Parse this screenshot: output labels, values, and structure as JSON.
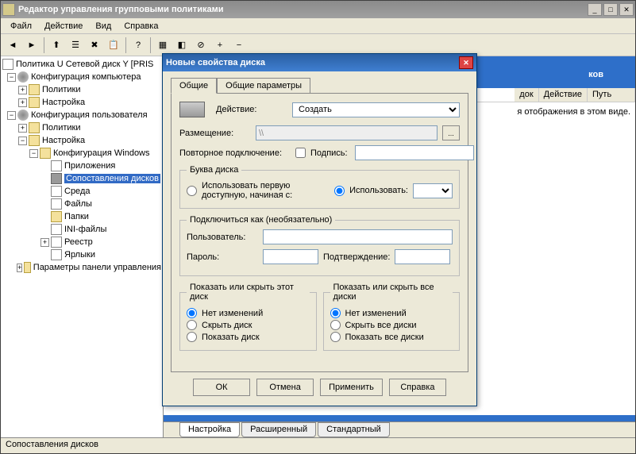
{
  "main": {
    "title": "Редактор управления групповыми политиками",
    "menu": [
      "Файл",
      "Действие",
      "Вид",
      "Справка"
    ],
    "status": "Сопоставления дисков"
  },
  "tree": {
    "root": "Политика U Сетевой диск Y [PRIS",
    "comp_config": "Конфигурация компьютера",
    "comp_policies": "Политики",
    "comp_settings": "Настройка",
    "user_config": "Конфигурация пользователя",
    "user_policies": "Политики",
    "user_settings": "Настройка",
    "win_config": "Конфигурация Windows",
    "apps": "Приложения",
    "drive_maps": "Сопоставления дисков",
    "env": "Среда",
    "files": "Файлы",
    "folders": "Папки",
    "ini": "INI-файлы",
    "registry": "Реестр",
    "shortcuts": "Ярлыки",
    "cpanel": "Параметры панели управления"
  },
  "right": {
    "header_suffix": "ков",
    "cols": {
      "order": "док",
      "action": "Действие",
      "path": "Путь"
    },
    "empty": "я отображения в этом виде.",
    "tabs": [
      "Настройка",
      "Расширенный",
      "Стандартный"
    ]
  },
  "dialog": {
    "title": "Новые свойства диска",
    "tabs": {
      "general": "Общие",
      "common": "Общие параметры"
    },
    "action_label": "Действие:",
    "action_value": "Создать",
    "location_label": "Размещение:",
    "location_value": "\\\\",
    "reconnect_label": "Повторное подключение:",
    "label_label": "Подпись:",
    "drive_letter_legend": "Буква диска",
    "use_first": "Использовать первую доступную, начиная с:",
    "use_letter": "Использовать:",
    "connect_as_legend": "Подключиться как (необязательно)",
    "user_label": "Пользователь:",
    "pass_label": "Пароль:",
    "confirm_label": "Подтверждение:",
    "hide_this_legend": "Показать или скрыть этот диск",
    "hide_all_legend": "Показать или скрыть все диски",
    "no_change": "Нет изменений",
    "hide_this": "Скрыть диск",
    "show_this": "Показать диск",
    "hide_all": "Скрыть все диски",
    "show_all": "Показать все диски",
    "buttons": {
      "ok": "ОК",
      "cancel": "Отмена",
      "apply": "Применить",
      "help": "Справка"
    }
  }
}
